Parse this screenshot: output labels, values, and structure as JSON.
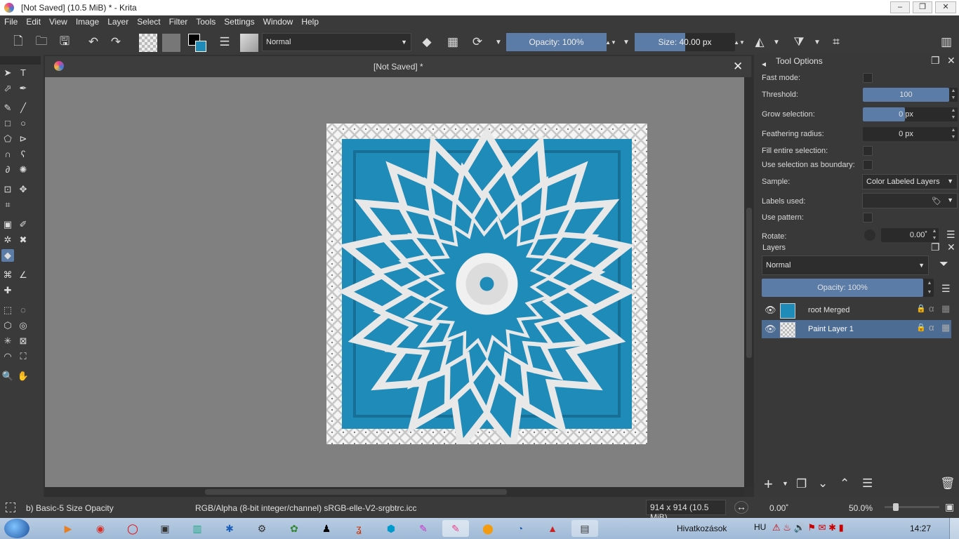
{
  "window": {
    "title": "[Not Saved]  (10.5 MiB)  * - Krita",
    "minimize": "‒",
    "maximize": "❐",
    "close": "✕"
  },
  "menu": [
    "File",
    "Edit",
    "View",
    "Image",
    "Layer",
    "Select",
    "Filter",
    "Tools",
    "Settings",
    "Window",
    "Help"
  ],
  "toolbar": {
    "blend_mode": "Normal",
    "opacity_label": "Opacity: 100%",
    "opacity_value": 1.0,
    "size_label": "Size: 40.00 px",
    "size_fill_fraction": 0.5
  },
  "document": {
    "tab_title": "[Not Saved]  *"
  },
  "tool_options": {
    "title": "Tool Options",
    "fast_mode_label": "Fast mode:",
    "threshold_label": "Threshold:",
    "threshold_value": "100",
    "grow_selection_label": "Grow selection:",
    "grow_selection_value": "0 px",
    "feathering_label": "Feathering radius:",
    "feathering_value": "0 px",
    "fill_entire_label": "Fill entire selection:",
    "use_boundary_label": "Use selection as boundary:",
    "sample_label": "Sample:",
    "sample_value": "Color Labeled Layers",
    "labels_used_label": "Labels used:",
    "use_pattern_label": "Use pattern:",
    "rotate_label": "Rotate:",
    "rotate_value": "0.00˚"
  },
  "layers": {
    "title": "Layers",
    "blend_mode": "Normal",
    "opacity_label": "Opacity:  100%",
    "items": [
      {
        "name": "root Merged",
        "selected": false
      },
      {
        "name": "Paint Layer 1",
        "selected": true
      }
    ]
  },
  "status": {
    "brush_preset": "b) Basic-5 Size Opacity",
    "color_space": "RGB/Alpha (8-bit integer/channel)  sRGB-elle-V2-srgbtrc.icc",
    "image_size": "914 x 914 (10.5 MiB)",
    "rotation": "0.00˚",
    "zoom": "50.0%"
  },
  "taskbar": {
    "links_label": "Hivatkozások",
    "language": "HU",
    "time": "14:27"
  },
  "colors": {
    "accent": "#5a7ca6",
    "artwork_blue": "#1e8bb8",
    "panel": "#393939"
  }
}
